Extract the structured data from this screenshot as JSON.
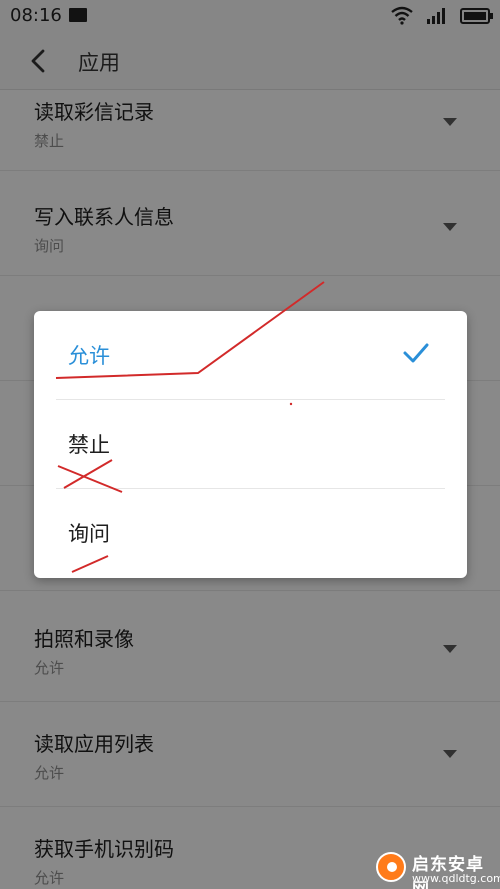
{
  "status_bar": {
    "time": "08:16",
    "icons": [
      "mail-icon",
      "wifi-icon",
      "signal-4g-icon",
      "battery-icon"
    ]
  },
  "app_bar": {
    "back_icon": "chevron-left-icon",
    "title": "应用"
  },
  "permissions": [
    {
      "title": "读取彩信记录",
      "value": "禁止"
    },
    {
      "title": "写入联系人信息",
      "value": "询问"
    },
    {
      "title": "",
      "value": ""
    },
    {
      "title": "",
      "value": ""
    },
    {
      "title": "",
      "value": ""
    },
    {
      "title": "拍照和录像",
      "value": "允许"
    },
    {
      "title": "读取应用列表",
      "value": "允许"
    },
    {
      "title": "获取手机识别码",
      "value": "允许"
    }
  ],
  "dialog": {
    "options": [
      {
        "label": "允许",
        "selected": true
      },
      {
        "label": "禁止",
        "selected": false
      },
      {
        "label": "询问",
        "selected": false
      }
    ],
    "selected_color": "#2a8fd8"
  },
  "annotation_color": "#d22a2a",
  "watermark": {
    "name": "启东安卓网",
    "url": "www.qdldtg.com"
  }
}
